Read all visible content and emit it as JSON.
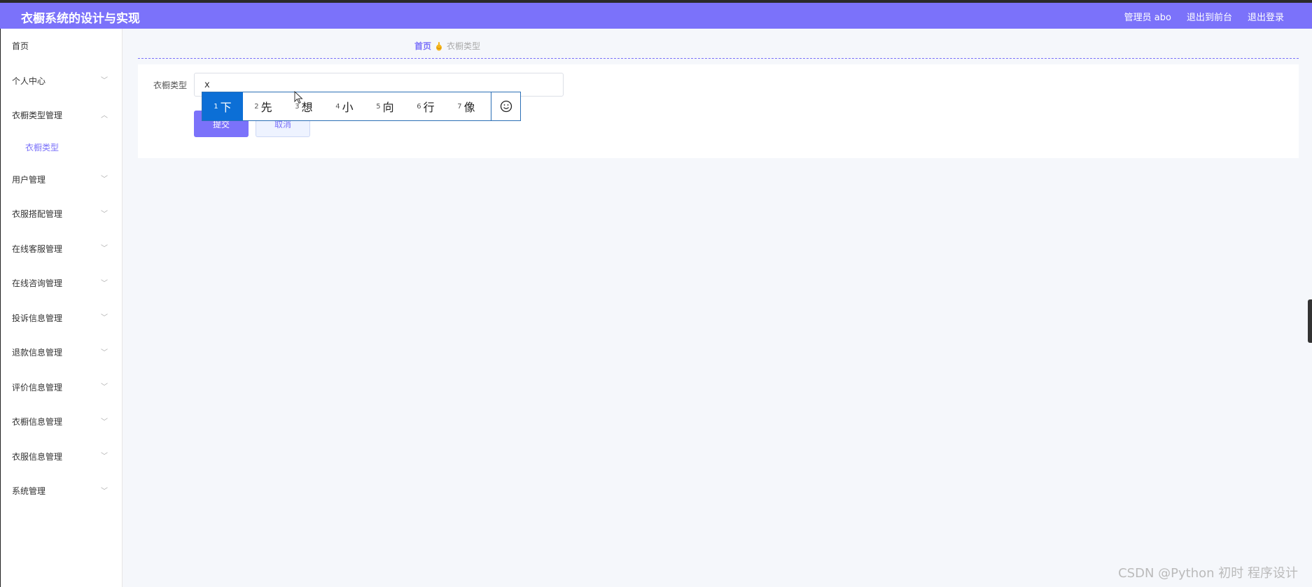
{
  "header": {
    "title": "衣橱系统的设计与实现",
    "admin_label": "管理员 abo",
    "to_front_label": "退出到前台",
    "logout_label": "退出登录"
  },
  "sidebar": {
    "items": [
      {
        "label": "首页",
        "chevron": ""
      },
      {
        "label": "个人中心",
        "chevron": "﹀"
      },
      {
        "label": "衣橱类型管理",
        "chevron": "︿"
      },
      {
        "label": "用户管理",
        "chevron": "﹀"
      },
      {
        "label": "衣服搭配管理",
        "chevron": "﹀"
      },
      {
        "label": "在线客服管理",
        "chevron": "﹀"
      },
      {
        "label": "在线咨询管理",
        "chevron": "﹀"
      },
      {
        "label": "投诉信息管理",
        "chevron": "﹀"
      },
      {
        "label": "退款信息管理",
        "chevron": "﹀"
      },
      {
        "label": "评价信息管理",
        "chevron": "﹀"
      },
      {
        "label": "衣橱信息管理",
        "chevron": "﹀"
      },
      {
        "label": "衣服信息管理",
        "chevron": "﹀"
      },
      {
        "label": "系统管理",
        "chevron": "﹀"
      }
    ],
    "sub_item": "衣橱类型"
  },
  "breadcrumb": {
    "home": "首页",
    "current": "衣橱类型"
  },
  "form": {
    "label": "衣橱类型",
    "value": "x",
    "submit_label": "提交",
    "cancel_label": "取消"
  },
  "ime": {
    "candidates": [
      {
        "num": "1",
        "char": "下"
      },
      {
        "num": "2",
        "char": "先"
      },
      {
        "num": "3",
        "char": "想"
      },
      {
        "num": "4",
        "char": "小"
      },
      {
        "num": "5",
        "char": "向"
      },
      {
        "num": "6",
        "char": "行"
      },
      {
        "num": "7",
        "char": "像"
      }
    ]
  },
  "watermark": "CSDN @Python 初时 程序设计",
  "colors": {
    "accent": "#7b72fa",
    "ime_active": "#0c6fd6"
  }
}
